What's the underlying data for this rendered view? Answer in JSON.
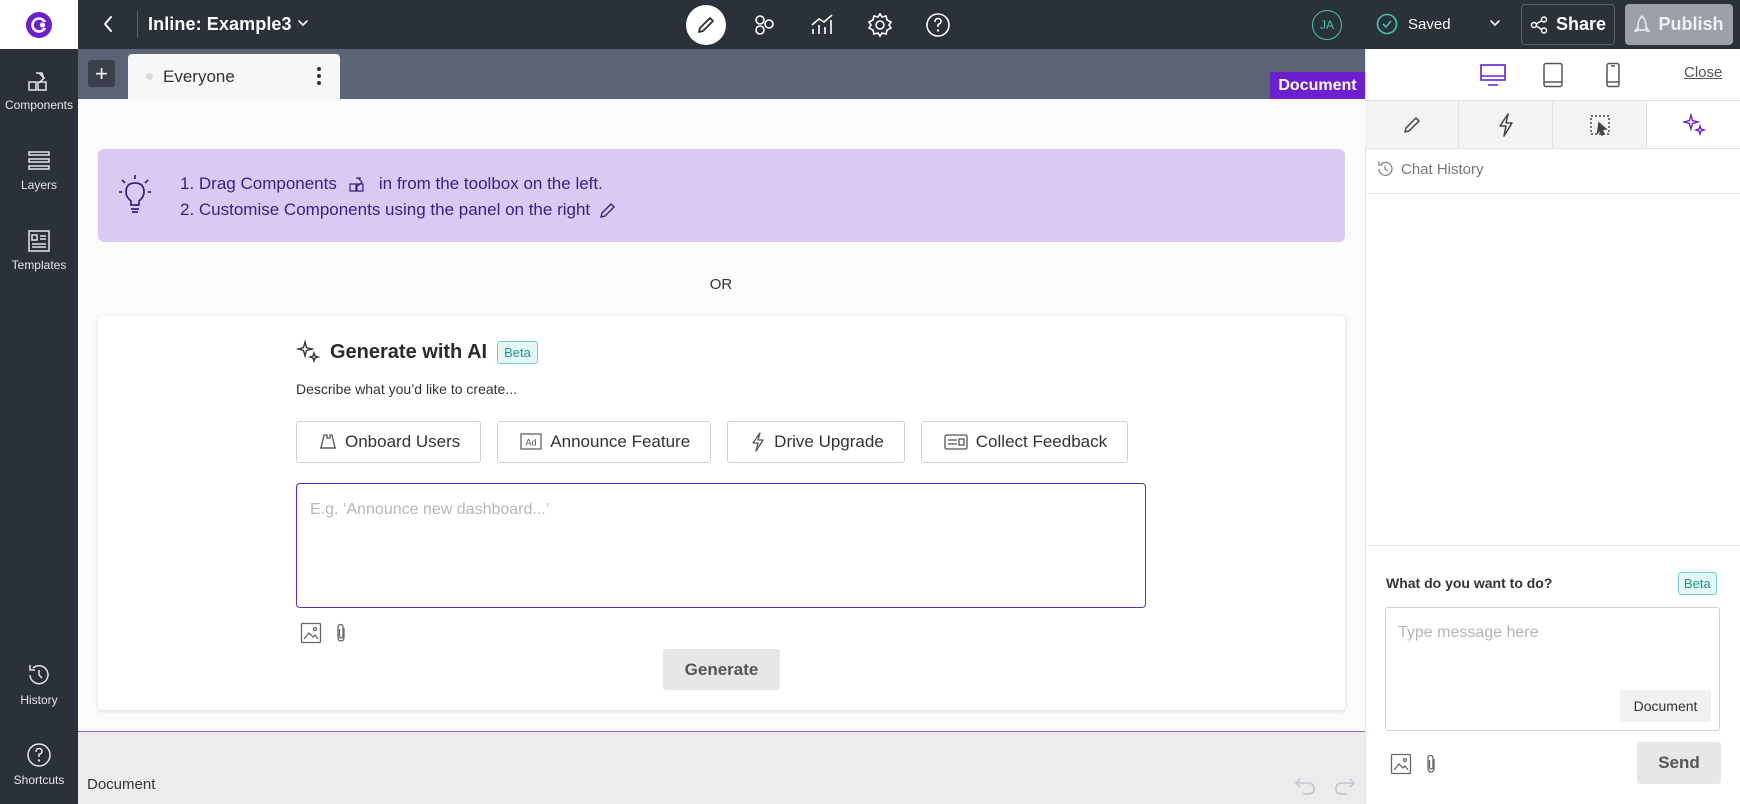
{
  "topbar": {
    "title": "Inline: Example3",
    "avatar_initials": "JA",
    "saved_label": "Saved",
    "share_label": "Share",
    "publish_label": "Publish"
  },
  "leftbar": {
    "items": [
      {
        "label": "Components",
        "icon": "components-icon"
      },
      {
        "label": "Layers",
        "icon": "layers-icon"
      },
      {
        "label": "Templates",
        "icon": "templates-icon"
      },
      {
        "label": "History",
        "icon": "history-icon"
      },
      {
        "label": "Shortcuts",
        "icon": "help-icon"
      }
    ]
  },
  "canvas": {
    "segment_tab": "Everyone",
    "document_tag": "Document",
    "tip_line1_a": "1. Drag Components",
    "tip_line1_b": "in from the toolbox on the left.",
    "tip_line2": "2. Customise Components using the panel on the right",
    "or_label": "OR",
    "generate": {
      "title": "Generate with AI",
      "beta": "Beta",
      "subtitle": "Describe what you’d like to create...",
      "chips": [
        "Onboard Users",
        "Announce Feature",
        "Drive Upgrade",
        "Collect Feedback"
      ],
      "placeholder": "E.g. ‘Announce new dashboard...’",
      "button": "Generate"
    }
  },
  "statusbar": {
    "label": "Document"
  },
  "rpanel": {
    "close_label": "Close",
    "chat_history_label": "Chat History",
    "ask_label": "What do you want to do?",
    "ask_beta": "Beta",
    "message_placeholder": "Type message here",
    "context_chip": "Document",
    "send_label": "Send"
  },
  "colors": {
    "topbar": "#2b3138",
    "accent_purple": "#6b1fcf",
    "tip_bg": "#dcc9f3",
    "beta_teal": "#1a9a8d"
  }
}
